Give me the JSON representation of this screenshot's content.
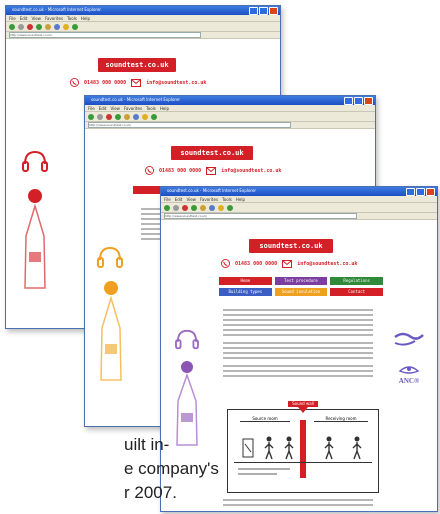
{
  "screens": [
    {
      "window_title": "soundtest.co.uk - Microsoft Internet Explorer",
      "menu": [
        "File",
        "Edit",
        "View",
        "Favorites",
        "Tools",
        "Help"
      ],
      "address": "http://www.soundtest.co.uk/",
      "logo": "soundtest.co.uk",
      "phone": "01483 000 0000",
      "email": "info@soundtest.co.uk"
    },
    {
      "window_title": "soundtest.co.uk - Microsoft Internet Explorer",
      "menu": [
        "File",
        "Edit",
        "View",
        "Favorites",
        "Tools",
        "Help"
      ],
      "address": "http://www.soundtest.co.uk/",
      "logo": "soundtest.co.uk",
      "phone": "01483 000 0000",
      "email": "info@soundtest.co.uk"
    },
    {
      "window_title": "soundtest.co.uk - Microsoft Internet Explorer",
      "menu": [
        "File",
        "Edit",
        "View",
        "Favorites",
        "Tools",
        "Help"
      ],
      "address": "http://www.soundtest.co.uk/",
      "logo": "soundtest.co.uk",
      "phone": "01483 000 0000",
      "email": "info@soundtest.co.uk",
      "nav": [
        "Home",
        "Test procedure",
        "Regulations",
        "Building types",
        "Sound insulation",
        "Contact"
      ],
      "diagram": {
        "top_label": "Sound wall",
        "left_label": "Source room",
        "right_label": "Receiving room"
      },
      "side_badge": "ANC®"
    }
  ],
  "caption": {
    "line1": "uilt in-",
    "line2": "e company's",
    "line3": "r 2007."
  },
  "colors": {
    "brand_red": "#d32027",
    "titlebar_blue": "#1c4fc4",
    "nav_red": "#d32027",
    "nav_purple": "#7b3fa0",
    "nav_green": "#2f8a3a",
    "nav_blue": "#3a5ec4",
    "nav_orange": "#f0a020"
  }
}
